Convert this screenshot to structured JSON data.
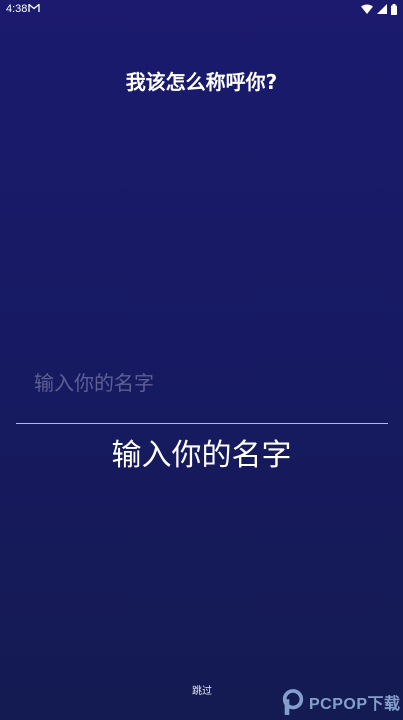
{
  "status_bar": {
    "time": "4:38",
    "icons": [
      "gmail-icon",
      "wifi-icon",
      "signal-icon",
      "battery-icon"
    ]
  },
  "screen": {
    "title": "我该怎么称呼你?",
    "name_input_placeholder": "输入你的名字",
    "name_display": "输入你的名字",
    "skip_label": "跳过"
  },
  "watermark": {
    "text": "PCPOP下载"
  },
  "colors": {
    "background_top": "#1b1a6e",
    "background_bottom": "#141b52",
    "text": "#ffffff",
    "placeholder": "#5d5f94",
    "underline": "#b9bad3",
    "watermark": "#a9cdf2"
  }
}
